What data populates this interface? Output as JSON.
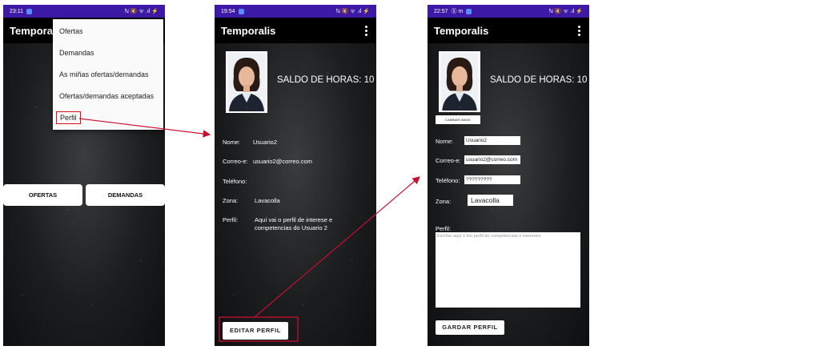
{
  "screens": {
    "menu": {
      "status_time": "23:11",
      "status_icons": "ℕ 🔇 ᯤ .ıl ⚡",
      "app_title": "Temporalis",
      "menu_items": [
        "Ofertas",
        "Demandas",
        "As miñas ofertas/demandas",
        "Ofertas/demandas aceptadas",
        "Perfil"
      ],
      "btn_ofertas": "OFERTAS",
      "btn_demandas": "DEMANDAS"
    },
    "profile": {
      "status_time": "19:54",
      "status_icons": "ℕ 🔇 ᯤ .ıl ⚡",
      "app_title": "Temporalis",
      "saldo": "SALDO DE HORAS: 10",
      "labels": {
        "nome": "Nome:",
        "correo": "Correo-e:",
        "telefono": "Teléfono:",
        "zona": "Zona:",
        "perfil": "Perfil:"
      },
      "values": {
        "nome": "Usuario2",
        "correo": "usuario2@correo.com",
        "telefono": "",
        "zona": "Lavacolla",
        "perfil": "Aquí vai o perfil de interese e competencias do Usuario 2"
      },
      "edit_button": "EDITAR PERFIL"
    },
    "edit": {
      "status_time": "22:57",
      "status_extra": "Ⓢ m",
      "status_icons": "ℕ 🔇 ᯤ .ıl ⚡",
      "app_title": "Temporalis",
      "saldo": "SALDO DE HORAS: 10",
      "change_image": "CAMBIAR IMAXE",
      "labels": {
        "nome": "Nome:",
        "correo": "Correo-e:",
        "telefono": "Teléfono:",
        "zona": "Zona:",
        "perfil": "Perfil:"
      },
      "values": {
        "nome": "Usuario2",
        "correo": "usuario2@correo.com",
        "telefono": "?????????",
        "zona": "Lavacolla"
      },
      "perfil_placeholder": "Escribe aquí o teu perfil de competencias e intereses",
      "save_button": "GARDAR PERFIL"
    }
  },
  "colors": {
    "statusbar": "#3d1aa6",
    "annotation": "#c8102e"
  }
}
